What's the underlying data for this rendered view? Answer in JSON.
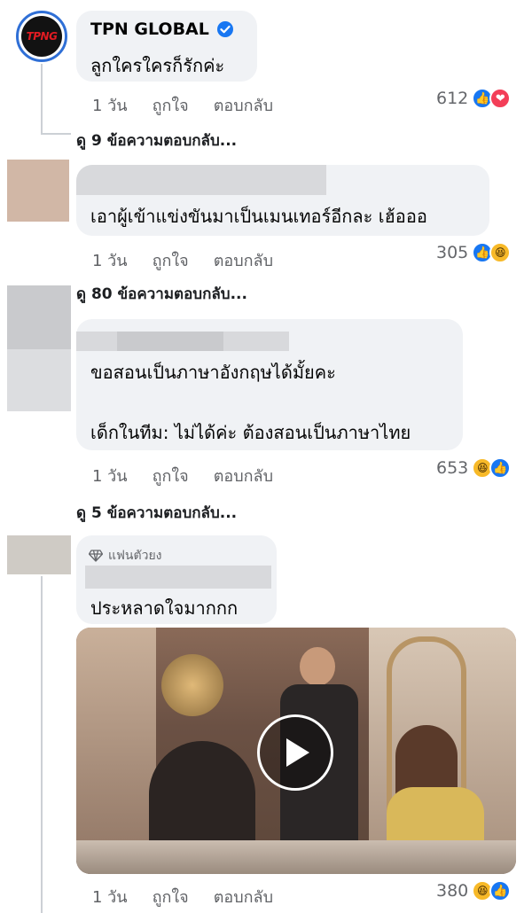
{
  "comments": [
    {
      "author": "TPN GLOBAL",
      "avatar_text": "TPNG",
      "text": "ลูกใครใครก็รักค่ะ",
      "time": "1 วัน",
      "like_label": "ถูกใจ",
      "reply_label": "ตอบกลับ",
      "reaction_count": "612",
      "reactions": [
        "like",
        "love"
      ],
      "view_replies": "ดู 9 ข้อความตอบกลับ..."
    },
    {
      "text": "เอาผู้เข้าแข่งขันมาเป็นเมนเทอร์อีกละ เฮ้อออ",
      "time": "1 วัน",
      "like_label": "ถูกใจ",
      "reply_label": "ตอบกลับ",
      "reaction_count": "305",
      "reactions": [
        "like",
        "haha"
      ],
      "view_replies": "ดู 80 ข้อความตอบกลับ..."
    },
    {
      "text_line1": "ขอสอนเป็นภาษาอังกฤษได้มั้ยคะ",
      "text_line2": "เด็กในทีม: ไม่ได้ค่ะ ต้องสอนเป็นภาษาไทย",
      "time": "1 วัน",
      "like_label": "ถูกใจ",
      "reply_label": "ตอบกลับ",
      "reaction_count": "653",
      "reactions": [
        "haha",
        "like"
      ],
      "view_replies": "ดู 5 ข้อความตอบกลับ..."
    },
    {
      "badge": "แฟนตัวยง",
      "text": "ประหลาดใจมากกก",
      "time": "1 วัน",
      "like_label": "ถูกใจ",
      "reply_label": "ตอบกลับ",
      "reaction_count": "380",
      "reactions": [
        "haha",
        "like"
      ]
    }
  ],
  "colors": {
    "bubble": "#f0f2f5",
    "like": "#1877f2",
    "love": "#f33e58",
    "haha": "#f7b928",
    "verified": "#1877f2"
  },
  "icons": [
    "verified-badge-icon",
    "like-reaction-icon",
    "love-reaction-icon",
    "haha-reaction-icon",
    "diamond-icon",
    "play-icon"
  ]
}
